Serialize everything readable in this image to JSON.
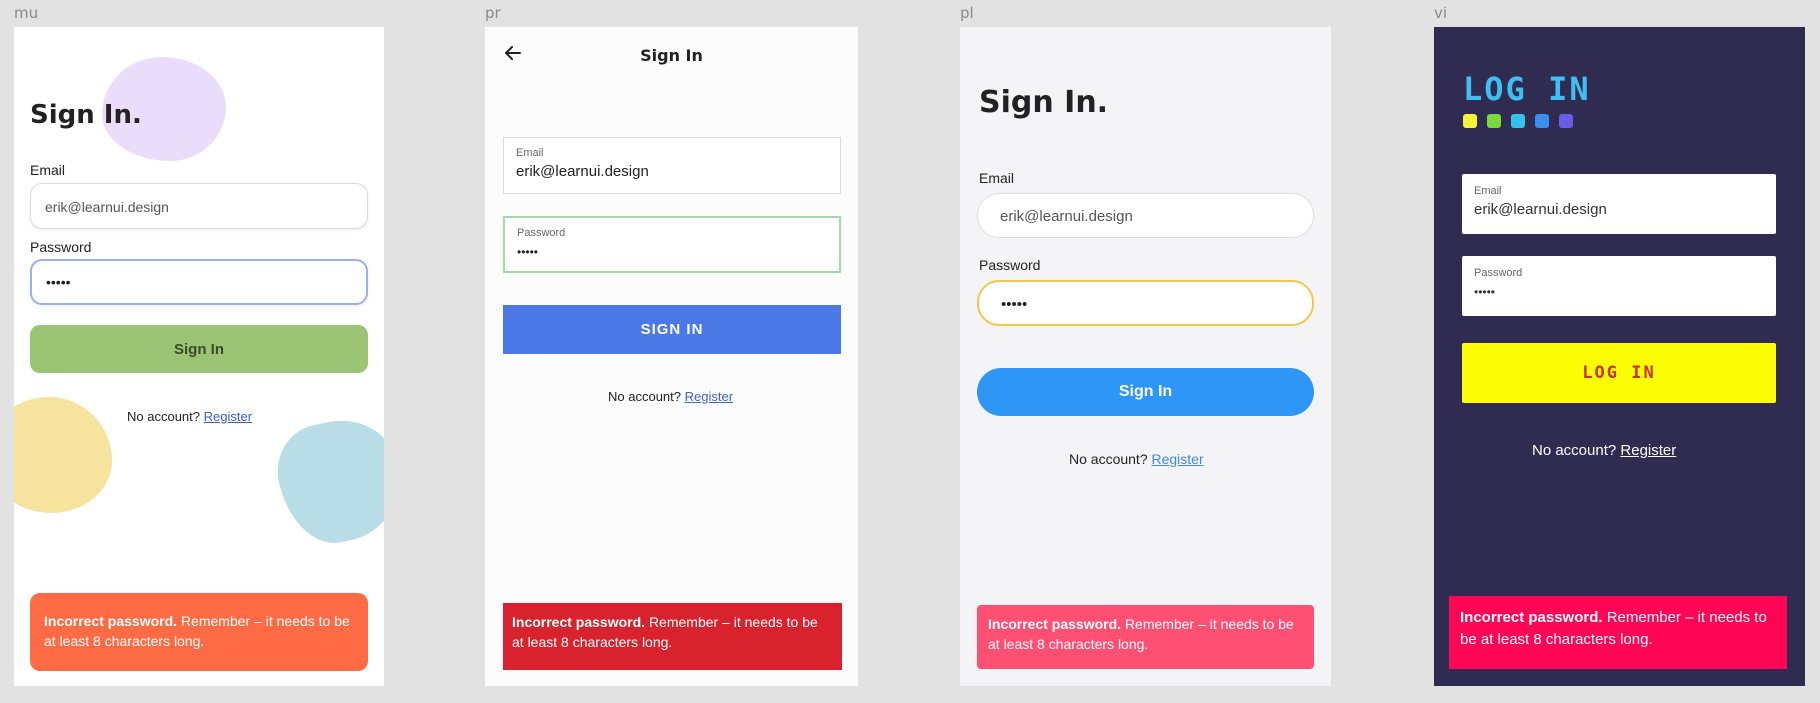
{
  "frames": [
    {
      "label": "mu",
      "title": "Sign In.",
      "email_label": "Email",
      "email_value": "erik@learnui.design",
      "password_label": "Password",
      "password_value": "•••••",
      "button_label": "Sign In",
      "no_account_text": "No account?",
      "register_link": "Register",
      "error_bold": "Incorrect password.",
      "error_text": "Remember – it needs to be at least 8 characters long."
    },
    {
      "label": "pr",
      "title": "Sign In",
      "email_label": "Email",
      "email_value": "erik@learnui.design",
      "password_label": "Password",
      "password_value": "•••••",
      "button_label": "SIGN IN",
      "no_account_text": "No account?",
      "register_link": "Register",
      "error_bold": "Incorrect password.",
      "error_text": "Remember – it needs to be at least 8 characters long."
    },
    {
      "label": "pl",
      "title": "Sign In.",
      "email_label": "Email",
      "email_value": "erik@learnui.design",
      "password_label": "Password",
      "password_value": "•••••",
      "button_label": "Sign In",
      "no_account_text": "No account?",
      "register_link": "Register",
      "error_bold": "Incorrect password.",
      "error_text": "Remember – it needs to be at least 8 characters long."
    },
    {
      "label": "vi",
      "title": "LOG IN",
      "email_label": "Email",
      "email_value": "erik@learnui.design",
      "password_label": "Password",
      "password_value": "•••••",
      "button_label": "LOG IN",
      "no_account_text": "No account?",
      "register_link": "Register",
      "error_bold": "Incorrect password.",
      "error_text": "Remember – it needs to be at least 8 characters long."
    }
  ],
  "icons": {
    "back": "back-arrow-icon"
  },
  "colors": {
    "mu_button": "#9bc474",
    "mu_error": "#ff6b45",
    "pr_button": "#4a78e6",
    "pr_error": "#d8232e",
    "pl_button": "#2e96f6",
    "pl_error": "#ff4f73",
    "vi_background": "#302c51",
    "vi_button": "#fcfc04",
    "vi_error": "#ff0555",
    "vi_logo_dots": [
      "#f5f33a",
      "#7ad93c",
      "#36c2e8",
      "#3b8ef0",
      "#6b5ce6"
    ]
  }
}
